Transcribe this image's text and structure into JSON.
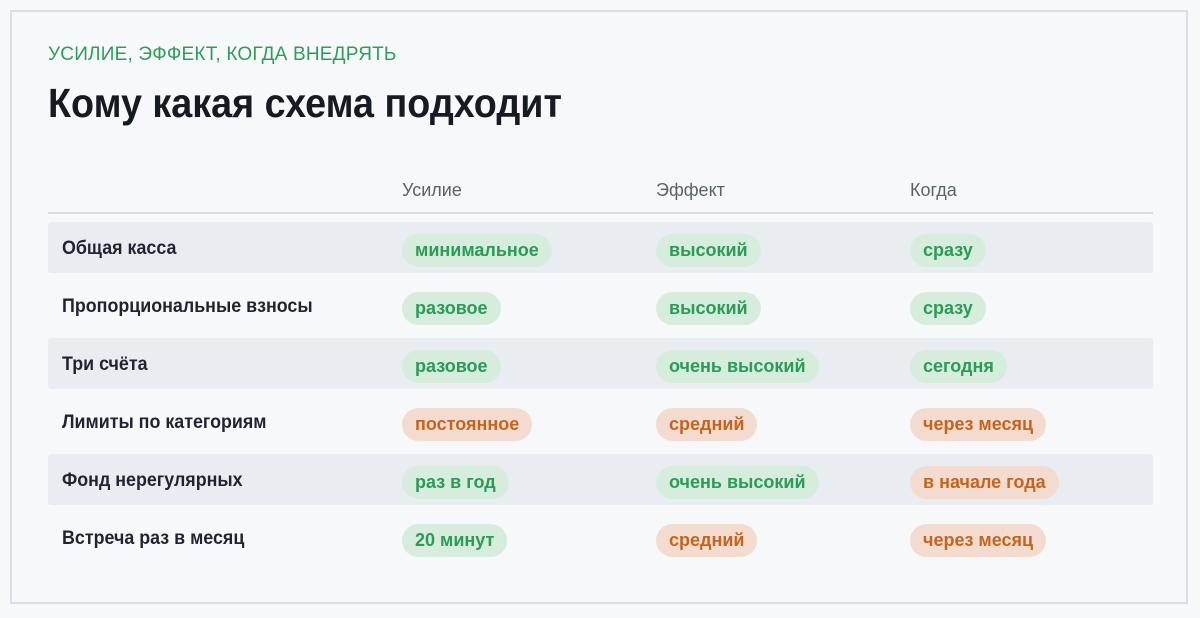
{
  "header": {
    "eyebrow": "УСИЛИЕ, ЭФФЕКТ, КОГДА ВНЕДРЯТЬ",
    "title": "Кому какая схема подходит"
  },
  "table": {
    "columns": [
      "",
      "Усилие",
      "Эффект",
      "Когда"
    ],
    "rows": [
      {
        "name": "Общая касса",
        "effort": {
          "text": "минимальное",
          "tone": "green"
        },
        "effect": {
          "text": "высокий",
          "tone": "green"
        },
        "when": {
          "text": "сразу",
          "tone": "green"
        }
      },
      {
        "name": "Пропорциональные взносы",
        "effort": {
          "text": "разовое",
          "tone": "green"
        },
        "effect": {
          "text": "высокий",
          "tone": "green"
        },
        "when": {
          "text": "сразу",
          "tone": "green"
        }
      },
      {
        "name": "Три счёта",
        "effort": {
          "text": "разовое",
          "tone": "green"
        },
        "effect": {
          "text": "очень высокий",
          "tone": "green"
        },
        "when": {
          "text": "сегодня",
          "tone": "green"
        }
      },
      {
        "name": "Лимиты по категориям",
        "effort": {
          "text": "постоянное",
          "tone": "orange"
        },
        "effect": {
          "text": "средний",
          "tone": "orange"
        },
        "when": {
          "text": "через месяц",
          "tone": "orange"
        }
      },
      {
        "name": "Фонд нерегулярных",
        "effort": {
          "text": "раз в год",
          "tone": "green"
        },
        "effect": {
          "text": "очень высокий",
          "tone": "green"
        },
        "when": {
          "text": "в начале года",
          "tone": "orange"
        }
      },
      {
        "name": "Встреча раз в месяц",
        "effort": {
          "text": "20 минут",
          "tone": "green"
        },
        "effect": {
          "text": "средний",
          "tone": "orange"
        },
        "when": {
          "text": "через месяц",
          "tone": "orange"
        }
      }
    ]
  },
  "colors": {
    "accent_green": "#2e9d5a",
    "pill_green_bg": "#d6ecdd",
    "pill_green_text": "#2b9b55",
    "pill_orange_bg": "#f3dccf",
    "pill_orange_text": "#c3651f"
  }
}
